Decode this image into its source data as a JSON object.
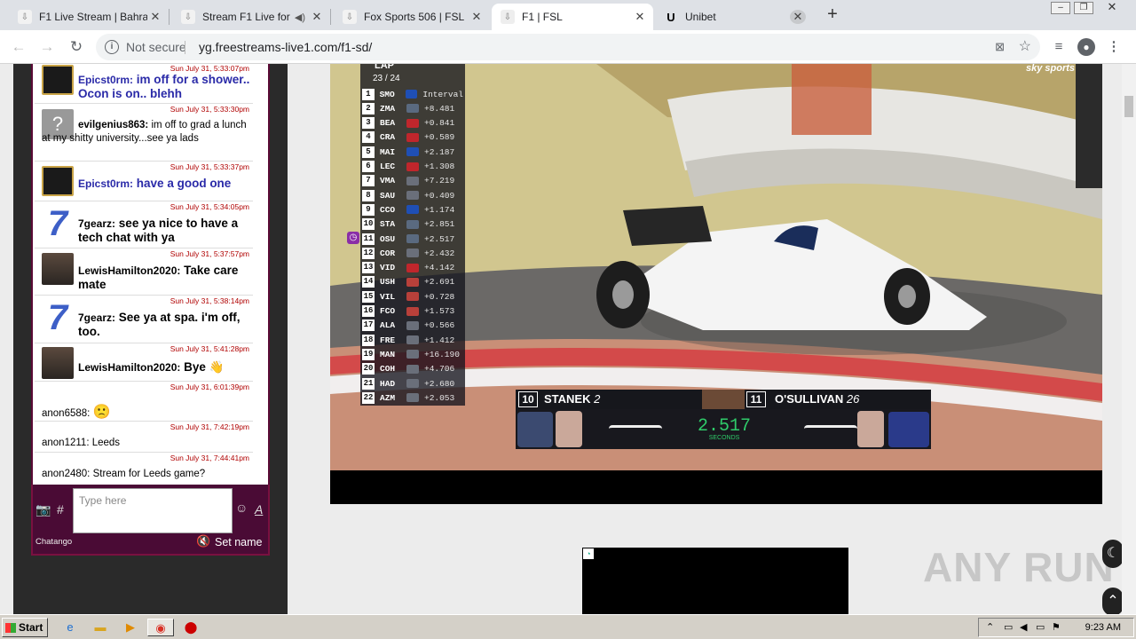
{
  "browser": {
    "tabs": [
      {
        "title": "F1 Live Stream | Bahrain",
        "active": false
      },
      {
        "title": "Stream F1 Live for f",
        "active": false
      },
      {
        "title": "Fox Sports 506 | FSL",
        "active": false
      },
      {
        "title": "F1 | FSL",
        "active": true
      },
      {
        "title": "Unibet",
        "active": false
      }
    ],
    "security_label": "Not secure",
    "url": "yg.freestreams-live1.com/f1-sd/"
  },
  "chat": {
    "messages": [
      {
        "time": "Sun July 31, 5:33:07pm",
        "user": "Epicst0rm:",
        "text": "im off for a shower.. Ocon is on.. blehh",
        "avatar": "lion"
      },
      {
        "time": "Sun July 31, 5:33:30pm",
        "user": "evilgenius863:",
        "text": "im off to grad a lunch at my shitty university...see ya lads",
        "avatar": "question"
      },
      {
        "time": "Sun July 31, 5:33:37pm",
        "user": "Epicst0rm:",
        "text": "have a good one",
        "avatar": "lion"
      },
      {
        "time": "Sun July 31, 5:34:05pm",
        "user": "7gearz:",
        "text": "see ya nice to have a tech chat with ya",
        "avatar": "seven"
      },
      {
        "time": "Sun July 31, 5:37:57pm",
        "user": "LewisHamilton2020:",
        "text": "Take care mate",
        "avatar": "photo"
      },
      {
        "time": "Sun July 31, 5:38:14pm",
        "user": "7gearz:",
        "text": "See ya at spa. i'm off, too.",
        "avatar": "seven"
      },
      {
        "time": "Sun July 31, 5:41:28pm",
        "user": "LewisHamilton2020:",
        "text": "Bye 👋",
        "avatar": "photo"
      },
      {
        "time": "Sun July 31, 6:01:39pm",
        "user": "anon6588:",
        "text": "🙁",
        "avatar": ""
      },
      {
        "time": "Sun July 31, 7:42:19pm",
        "user": "anon1211:",
        "text": "Leeds",
        "avatar": ""
      },
      {
        "time": "Sun July 31, 7:44:41pm",
        "user": "anon2480:",
        "text": "Stream for Leeds game?",
        "avatar": ""
      }
    ],
    "input_placeholder": "Type here",
    "brand": "Chatango",
    "set_name": "Set name",
    "hash": "#",
    "font_a": "A"
  },
  "video": {
    "lap_label": "LAP",
    "lap": "23 / 24",
    "interval_label": "Interval",
    "leaderboard": [
      {
        "pos": "1",
        "code": "SMO",
        "gap": "Interval",
        "color": "#1f4fb5"
      },
      {
        "pos": "2",
        "code": "ZMA",
        "gap": "+8.481",
        "color": "#5a6a80"
      },
      {
        "pos": "3",
        "code": "BEA",
        "gap": "+0.841",
        "color": "#c0262c"
      },
      {
        "pos": "4",
        "code": "CRA",
        "gap": "+0.589",
        "color": "#c0262c"
      },
      {
        "pos": "5",
        "code": "MAI",
        "gap": "+2.187",
        "color": "#1f4fb5"
      },
      {
        "pos": "6",
        "code": "LEC",
        "gap": "+1.308",
        "color": "#c0262c"
      },
      {
        "pos": "7",
        "code": "VMA",
        "gap": "+7.219",
        "color": "#6a6f7a"
      },
      {
        "pos": "8",
        "code": "SAU",
        "gap": "+0.409",
        "color": "#6a6f7a"
      },
      {
        "pos": "9",
        "code": "CCO",
        "gap": "+1.174",
        "color": "#1f4fb5"
      },
      {
        "pos": "10",
        "code": "STA",
        "gap": "+2.851",
        "color": "#5a6a80"
      },
      {
        "pos": "11",
        "code": "OSU",
        "gap": "+2.517",
        "color": "#5a6a80"
      },
      {
        "pos": "12",
        "code": "COR",
        "gap": "+2.432",
        "color": "#6a6f7a"
      },
      {
        "pos": "13",
        "code": "VID",
        "gap": "+4.142",
        "color": "#c0262c"
      },
      {
        "pos": "14",
        "code": "USH",
        "gap": "+2.691",
        "color": "#b8403a"
      },
      {
        "pos": "15",
        "code": "VIL",
        "gap": "+0.728",
        "color": "#b8403a"
      },
      {
        "pos": "16",
        "code": "FCO",
        "gap": "+1.573",
        "color": "#b8403a"
      },
      {
        "pos": "17",
        "code": "ALA",
        "gap": "+0.566",
        "color": "#6a6f7a"
      },
      {
        "pos": "18",
        "code": "FRE",
        "gap": "+1.412",
        "color": "#6a6f7a"
      },
      {
        "pos": "19",
        "code": "MAN",
        "gap": "+16.190",
        "color": "#6a6f7a"
      },
      {
        "pos": "20",
        "code": "COH",
        "gap": "+4.706",
        "color": "#6a6f7a"
      },
      {
        "pos": "21",
        "code": "HAD",
        "gap": "+2.680",
        "color": "#6a6f7a"
      },
      {
        "pos": "22",
        "code": "AZM",
        "gap": "+2.053",
        "color": "#6a6f7a"
      }
    ],
    "battle": {
      "left_num": "10",
      "left_name": "STANEK",
      "left_sub": "2",
      "right_num": "11",
      "right_name": "O'SULLIVAN",
      "right_sub": "26",
      "gap": "2.517",
      "gap_label": "SECONDS"
    },
    "broadcaster": "sky sports"
  },
  "watermark": "ANY RUN",
  "taskbar": {
    "start": "Start",
    "time": "9:23 AM"
  }
}
